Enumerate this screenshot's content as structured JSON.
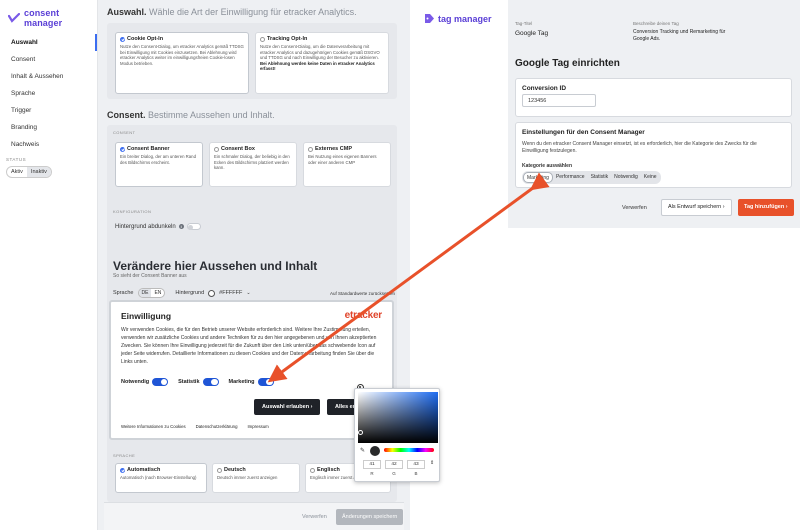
{
  "consent_manager": {
    "logo_text": "consent manager",
    "sidebar": {
      "items": [
        {
          "label": "Auswahl",
          "active": true
        },
        {
          "label": "Consent",
          "active": false
        },
        {
          "label": "Inhalt & Aussehen",
          "active": false
        },
        {
          "label": "Sprache",
          "active": false
        },
        {
          "label": "Trigger",
          "active": false
        },
        {
          "label": "Branding",
          "active": false
        },
        {
          "label": "Nachweis",
          "active": false
        }
      ],
      "status_label": "STATUS",
      "status_options": [
        "Aktiv",
        "Inaktiv"
      ],
      "status_selected": "Inaktiv"
    },
    "auswahl": {
      "heading": "Auswahl.",
      "subheading": "Wähle die Art der Einwilligung für etracker Analytics.",
      "cards": [
        {
          "title": "Cookie Opt-In",
          "desc": "Nutze den Consent-Dialog, um etracker Analytics gemäß TTDSG bei Einwilligung mit Cookies einzusetzen. Bei Ablehnung wird etracker Analytics weiter im einwilligungsfreien Cookie-losen Modus betrieben.",
          "selected": true
        },
        {
          "title": "Tracking Opt-In",
          "desc": "Nutze den Consent-Dialog, um die Datenverarbeitung mit etracker Analytics und dazugehörigen Cookies gemäß DSGVO und TTDSG und nach Einwilligung der Besucher zu aktivieren.",
          "desc_bold": "Bei Ablehnung werden keine Daten in etracker Analytics erfasst!",
          "selected": false
        }
      ]
    },
    "consent": {
      "heading": "Consent.",
      "subheading": "Bestimme Aussehen und Inhalt.",
      "panel_label": "CONSENT",
      "cards": [
        {
          "title": "Consent Banner",
          "desc": "Ein breiter Dialog, der am unteren Rand des Bildschirms erscheint.",
          "selected": true
        },
        {
          "title": "Consent Box",
          "desc": "Ein schmaler Dialog, der beliebig in den Ecken des Bildschirms platziert werden kann.",
          "selected": false
        },
        {
          "title": "Externes CMP",
          "desc": "Bei Nutzung eines eigenen Banners oder einer anderen CMP",
          "selected": false
        }
      ],
      "config_label": "KONFIGURATION",
      "darken_label": "Hintergrund abdunkeln"
    },
    "appearance": {
      "heading": "Verändere hier Aussehen und Inhalt",
      "subheading": "So sieht der Consent Banner aus",
      "language_label": "Sprache",
      "languages": [
        "DE",
        "EN"
      ],
      "language_selected": "DE",
      "background_label": "Hintergrund",
      "background_value": "#FFFFFF",
      "reset_label": "Auf Standardwerte zurücksetzen"
    },
    "banner": {
      "title": "Einwilligung",
      "brand": "etracker",
      "text": "Wir verwenden Cookies, die für den Betrieb unserer Website erforderlich sind. Weitere Ihre Zustimmung erteilen, verwenden wir zusätzliche Cookies und andere Techniken für zu den hier angegebenen und von Ihnen akzeptierten Zwecken. Sie können Ihre Einwilligung jederzeit für die Zukunft über den Link unten/über das schwebende Icon auf jeder Seite widerrufen. Detaillierte Informationen zu diesen Cookies und der Datenverarbeitung finden Sie über die Links unten.",
      "toggles": [
        {
          "label": "Notwendig"
        },
        {
          "label": "Statistik"
        },
        {
          "label": "Marketing"
        }
      ],
      "btn_selection": "Auswahl erlauben",
      "btn_all": "Alles erl",
      "links": [
        "Weitere Informationen zu Cookies",
        "Datenschutzerklärung",
        "Impressum"
      ]
    },
    "sprache": {
      "panel_label": "SPRACHE",
      "cards": [
        {
          "title": "Automatisch",
          "desc": "Automatisch (nach Browser-Einstellung)",
          "selected": true
        },
        {
          "title": "Deutsch",
          "desc": "Deutsch immer zuerst anzeigen",
          "selected": false
        },
        {
          "title": "Englisch",
          "desc": "Englisch immer zuerst anzeigen",
          "selected": false
        }
      ]
    },
    "footer": {
      "cancel": "Verwerfen",
      "save": "Änderungen speichern"
    },
    "color_picker": {
      "r": "41",
      "g": "42",
      "b": "43",
      "label_r": "R",
      "label_g": "G",
      "label_b": "B"
    }
  },
  "tag_manager": {
    "logo_text": "tag manager",
    "tag_title_label": "Tag-Titel",
    "tag_title_value": "Google Tag",
    "tag_desc_label": "Beschreibe deinen Tag",
    "tag_desc_value": "Conversion Tracking und Remarketing für Google Ads.",
    "section_title": "Google Tag einrichten",
    "conversion_label": "Conversion ID",
    "conversion_value": "123456",
    "consent_card_title": "Einstellungen für den Consent Manager",
    "consent_card_desc": "Wenn du den etracker Consent Manager einsetzt, ist es erforderlich, hier die Kategorie des Zwecks für die Einwilligung festzulegen.",
    "category_label": "Kategorie auswählen",
    "categories": [
      "Marketing",
      "Performance",
      "Statistik",
      "Notwendig",
      "Keine"
    ],
    "category_selected": "Marketing",
    "btn_discard": "Verwerfen",
    "btn_draft": "Als Entwurf speichern",
    "btn_add": "Tag hinzufügen"
  },
  "colors": {
    "brand_purple": "#5a3fd6",
    "accent_blue": "#1f55d6",
    "etracker_red": "#e0442a",
    "cta_orange": "#e8512a"
  }
}
